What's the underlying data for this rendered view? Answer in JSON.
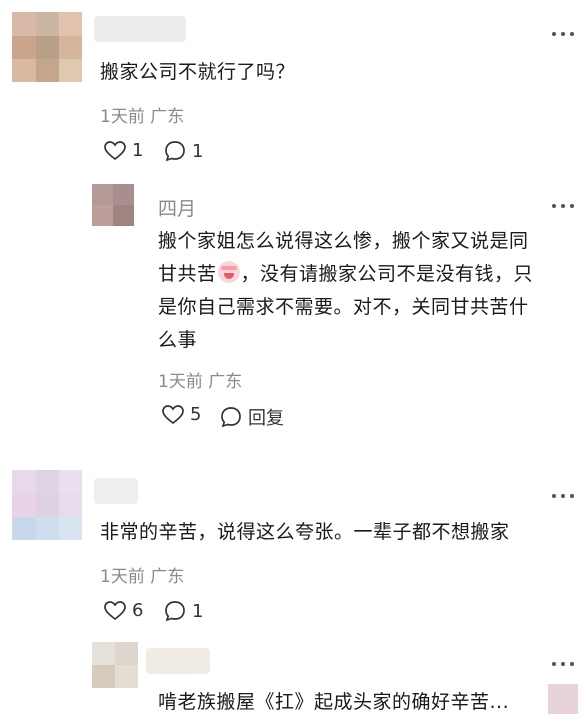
{
  "comments": [
    {
      "text": "搬家公司不就行了吗？",
      "meta": "1天前 广东",
      "likes": "1",
      "replies": "1"
    },
    {
      "name": "四月",
      "lines": [
        "搬个家姐怎么说得这么惨，搬个家又说是同",
        "甘共苦",
        "，没有请搬家公司不是没有钱，只",
        "是你自己需求不需要。对不，关同甘共苦什",
        "么事"
      ],
      "meta": "1天前 广东",
      "likes": "5",
      "reply_label": "回复"
    },
    {
      "text": "非常的辛苦，说得这么夸张。一辈子都不想搬家",
      "meta": "1天前 广东",
      "likes": "6",
      "replies": "1"
    },
    {
      "text": "啃老族搬屋《扛》起成头家的确好辛苦..."
    }
  ],
  "emoji": "crying-laughing-face",
  "colors": {
    "text": "#1a1a1a",
    "meta": "#8a8a8a"
  }
}
